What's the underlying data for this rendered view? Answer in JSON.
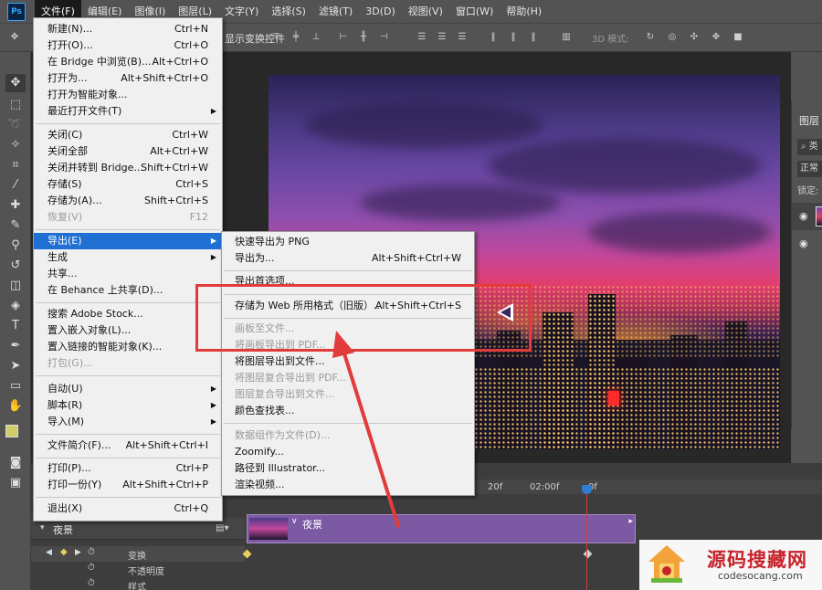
{
  "menubar": {
    "logo": "Ps",
    "items": [
      "文件(F)",
      "编辑(E)",
      "图像(I)",
      "图层(L)",
      "文字(Y)",
      "选择(S)",
      "滤镜(T)",
      "3D(D)",
      "视图(V)",
      "窗口(W)",
      "帮助(H)"
    ]
  },
  "options": {
    "show_transform": "显示变换控件",
    "mode_3d": "3D 模式:"
  },
  "file_menu": {
    "items": [
      {
        "label": "新建(N)...",
        "shortcut": "Ctrl+N"
      },
      {
        "label": "打开(O)...",
        "shortcut": "Ctrl+O"
      },
      {
        "label": "在 Bridge 中浏览(B)...",
        "shortcut": "Alt+Ctrl+O"
      },
      {
        "label": "打开为...",
        "shortcut": "Alt+Shift+Ctrl+O"
      },
      {
        "label": "打开为智能对象...",
        "shortcut": ""
      },
      {
        "label": "最近打开文件(T)",
        "shortcut": ""
      },
      {
        "label": "关闭(C)",
        "shortcut": "Ctrl+W"
      },
      {
        "label": "关闭全部",
        "shortcut": "Alt+Ctrl+W"
      },
      {
        "label": "关闭并转到 Bridge...",
        "shortcut": "Shift+Ctrl+W"
      },
      {
        "label": "存储(S)",
        "shortcut": "Ctrl+S"
      },
      {
        "label": "存储为(A)...",
        "shortcut": "Shift+Ctrl+S"
      },
      {
        "label": "恢复(V)",
        "shortcut": "F12"
      },
      {
        "label": "导出(E)",
        "shortcut": ""
      },
      {
        "label": "生成",
        "shortcut": ""
      },
      {
        "label": "共享...",
        "shortcut": ""
      },
      {
        "label": "在 Behance 上共享(D)...",
        "shortcut": ""
      },
      {
        "label": "搜索 Adobe Stock...",
        "shortcut": ""
      },
      {
        "label": "置入嵌入对象(L)...",
        "shortcut": ""
      },
      {
        "label": "置入链接的智能对象(K)...",
        "shortcut": ""
      },
      {
        "label": "打包(G)...",
        "shortcut": ""
      },
      {
        "label": "自动(U)",
        "shortcut": ""
      },
      {
        "label": "脚本(R)",
        "shortcut": ""
      },
      {
        "label": "导入(M)",
        "shortcut": ""
      },
      {
        "label": "文件简介(F)...",
        "shortcut": "Alt+Shift+Ctrl+I"
      },
      {
        "label": "打印(P)...",
        "shortcut": "Ctrl+P"
      },
      {
        "label": "打印一份(Y)",
        "shortcut": "Alt+Shift+Ctrl+P"
      },
      {
        "label": "退出(X)",
        "shortcut": "Ctrl+Q"
      }
    ]
  },
  "export_menu": {
    "items": [
      {
        "label": "快速导出为 PNG",
        "shortcut": ""
      },
      {
        "label": "导出为...",
        "shortcut": "Alt+Shift+Ctrl+W"
      },
      {
        "label": "导出首选项...",
        "shortcut": ""
      },
      {
        "label": "存储为 Web 所用格式（旧版）...",
        "shortcut": "Alt+Shift+Ctrl+S"
      },
      {
        "label": "画板至文件...",
        "shortcut": ""
      },
      {
        "label": "将画板导出到 PDF...",
        "shortcut": ""
      },
      {
        "label": "将图层导出到文件...",
        "shortcut": ""
      },
      {
        "label": "将图层复合导出到 PDF...",
        "shortcut": ""
      },
      {
        "label": "图层复合导出到文件...",
        "shortcut": ""
      },
      {
        "label": "颜色查找表...",
        "shortcut": ""
      },
      {
        "label": "数据组作为文件(D)...",
        "shortcut": ""
      },
      {
        "label": "Zoomify...",
        "shortcut": ""
      },
      {
        "label": "路径到 Illustrator...",
        "shortcut": ""
      },
      {
        "label": "渲染视频...",
        "shortcut": ""
      }
    ]
  },
  "layers_panel": {
    "title": "图层",
    "search": "类",
    "blend_mode": "正常",
    "lock": "锁定:"
  },
  "timeline": {
    "times": [
      "20f",
      "02:00f",
      "0f"
    ],
    "layer_name": "夜景",
    "clip_name": "夜景",
    "props": [
      "变换",
      "不透明度",
      "样式"
    ]
  },
  "watermark": {
    "title": "源码搜藏网",
    "url": "codesocang.com"
  },
  "colors": {
    "accent": "#1f70d2",
    "annotation": "#e23b3b",
    "clip": "#7c5aa3",
    "foreground": "#d1cc6a"
  }
}
